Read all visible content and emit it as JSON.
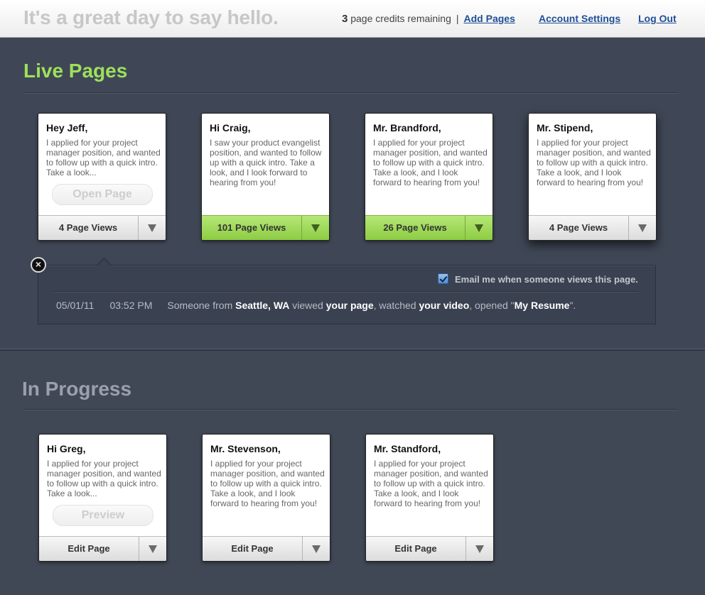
{
  "header": {
    "tagline": "It's a great day to say hello.",
    "credits_count": "3",
    "credits_text": "page credits remaining",
    "separator": "|",
    "add_pages": "Add Pages",
    "account_settings": "Account Settings",
    "log_out": "Log Out"
  },
  "live": {
    "title": "Live Pages",
    "cards": [
      {
        "greeting": "Hey Jeff,",
        "body": "I applied for your project manager position, and wanted to follow up with a quick intro. Take a look...",
        "action": "Open Page",
        "footer": "4 Page Views"
      },
      {
        "greeting": "Hi Craig,",
        "body": "I saw your product evangelist position, and wanted to follow up with a quick intro. Take a look, and I look forward to hearing from you!",
        "footer": "101 Page Views"
      },
      {
        "greeting": "Mr. Brandford,",
        "body": "I applied for your project manager position, and wanted to follow up with a quick intro. Take a look, and I look forward to hearing from you!",
        "footer": "26 Page Views"
      },
      {
        "greeting": "Mr. Stipend,",
        "body": "I applied for your project manager position, and wanted to follow up with a quick intro. Take a look, and I look forward to hearing from you!",
        "footer": "4 Page Views"
      }
    ],
    "activity": {
      "close_glyph": "×",
      "email_label": "Email me when someone views this page.",
      "email_checked": true,
      "date": "05/01/11",
      "time": "03:52 PM",
      "text_someone": "Someone from ",
      "location": "Seattle, WA",
      "text_viewed": " viewed ",
      "page": "your page",
      "text_watched": ", watched ",
      "video": "your video",
      "text_opened": ", opened \"",
      "document": "My Resume",
      "text_end": "\"."
    }
  },
  "progress": {
    "title": "In Progress",
    "cards": [
      {
        "greeting": "Hi Greg,",
        "body": "I applied for your project manager position, and wanted to follow up with a quick intro. Take a look...",
        "action": "Preview",
        "footer": "Edit Page"
      },
      {
        "greeting": "Mr. Stevenson,",
        "body": "I applied for your project manager position, and wanted to follow up with a quick intro. Take a look, and I look forward to hearing from you!",
        "footer": "Edit Page"
      },
      {
        "greeting": "Mr. Standford,",
        "body": "I applied for your project manager position, and wanted to follow up with a quick intro. Take a look, and I look forward to hearing from you!",
        "footer": "Edit Page"
      }
    ]
  },
  "colors": {
    "accent_green": "#9ee05a",
    "link_blue": "#1f4f98",
    "background": "#3f4756"
  }
}
